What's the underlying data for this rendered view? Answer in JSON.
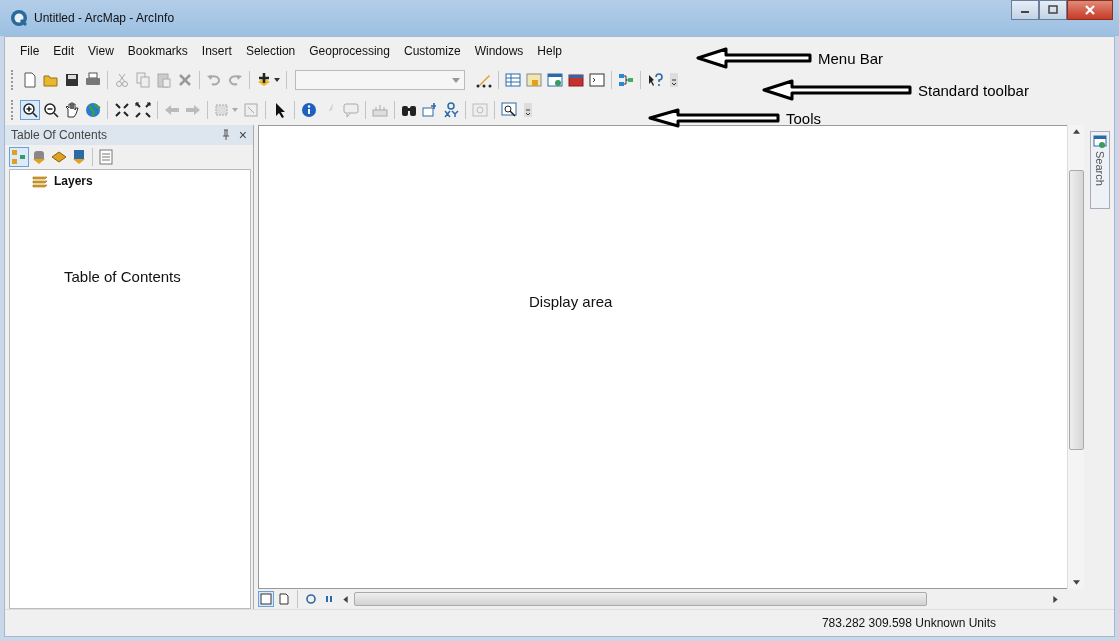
{
  "window": {
    "title": "Untitled - ArcMap - ArcInfo"
  },
  "menu_bar": [
    "File",
    "Edit",
    "View",
    "Bookmarks",
    "Insert",
    "Selection",
    "Geoprocessing",
    "Customize",
    "Windows",
    "Help"
  ],
  "annotations": [
    {
      "label": "Menu Bar"
    },
    {
      "label": "Standard toolbar"
    },
    {
      "label": "Tools"
    }
  ],
  "table_of_contents": {
    "title": "Table Of Contents",
    "close": "×",
    "layers": "Layers",
    "annotation": "Table of Contents"
  },
  "display_area": {
    "annotation": "Display area"
  },
  "side_tab": {
    "label": "Search"
  },
  "status_bar": {
    "coordinates": "783.282  309.598 Unknown Units"
  }
}
